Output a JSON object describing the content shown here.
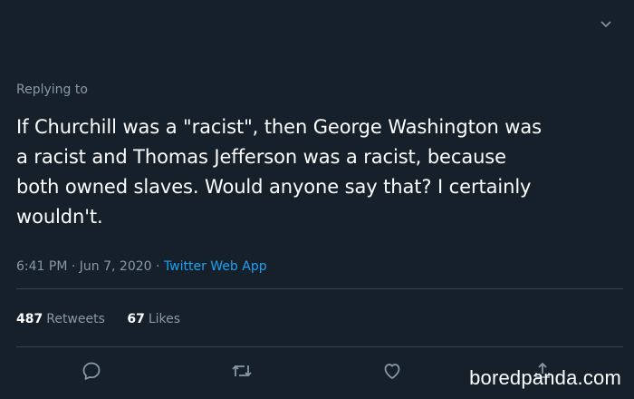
{
  "tweet": {
    "replying_label": "Replying to",
    "text": "If Churchill was a \"racist\", then George Washington was\na racist and Thomas Jefferson was a racist, because\nboth owned slaves. Would anyone say that? I certainly\nwouldn't.",
    "time": "6:41 PM",
    "date": "Jun 7, 2020",
    "separator": "·",
    "source": "Twitter Web App",
    "retweets_count": "487",
    "retweets_label": "Retweets",
    "likes_count": "67",
    "likes_label": "Likes"
  },
  "icons": {
    "menu": "chevron-down-icon",
    "reply": "reply-icon",
    "retweet": "retweet-icon",
    "like": "heart-icon",
    "share": "share-icon"
  },
  "watermark": "boredpanda.com",
  "colors": {
    "background": "#15202b",
    "text": "#ffffff",
    "secondary": "#8899a6",
    "link": "#1da1f2",
    "divider": "#38444d"
  }
}
